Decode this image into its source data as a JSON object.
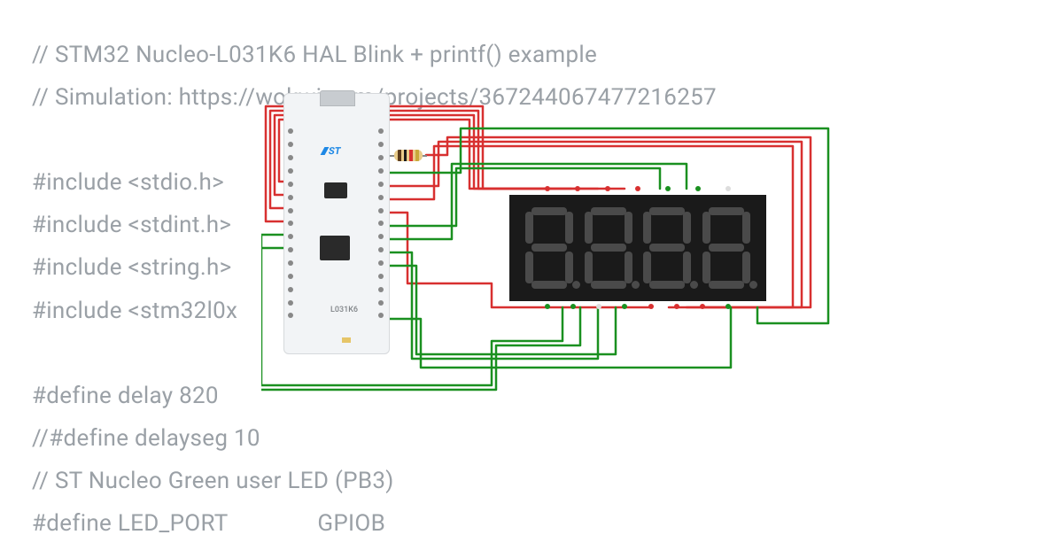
{
  "code": {
    "l1": "// STM32 Nucleo-L031K6 HAL Blink + printf() example",
    "l2": "// Simulation: https://wokwi.com/projects/367244067477216257",
    "l3": "",
    "l4": "#include <stdio.h>",
    "l5": "#include <stdint.h>",
    "l6": "#include <string.h>",
    "l7": "#include <stm32l0x",
    "l8": "",
    "l9": "#define delay 820",
    "l10": "//#define delayseg 10",
    "l11": "// ST Nucleo Green user LED (PB3)",
    "l12": "#define LED_PORT               GPIOB"
  },
  "board": {
    "logo": "ST",
    "label": "L031K6"
  },
  "components": {
    "resistor": "resistor",
    "display": "4-digit 7-segment"
  }
}
